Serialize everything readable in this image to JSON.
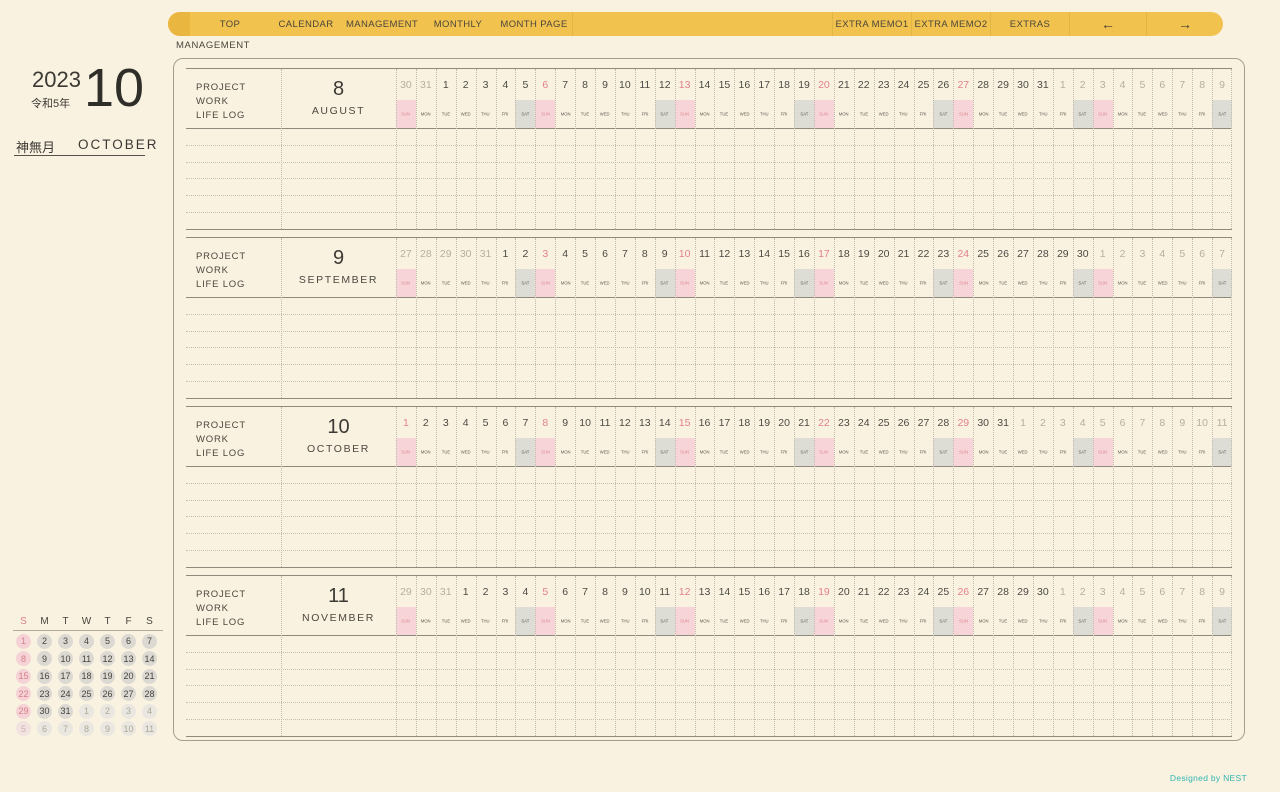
{
  "page_label": "MANAGEMENT",
  "nav": {
    "bar_color": "#F2C24F",
    "left_items": [
      "TOP",
      "CALENDAR",
      "MANAGEMENT",
      "MONTHLY",
      "MONTH PAGE"
    ],
    "right_items": [
      "EXTRA MEMO1",
      "EXTRA MEMO2",
      "EXTRAS"
    ],
    "prev_arrow": "←",
    "next_arrow": "→"
  },
  "sidebar": {
    "year": "2023",
    "era": "令和5年",
    "month_number": "10",
    "month_jp": "神無月",
    "month_en": "OCTOBER",
    "mini_calendar": {
      "weekday_header": [
        "S",
        "M",
        "T",
        "W",
        "T",
        "F",
        "S"
      ],
      "weeks": [
        [
          {
            "d": 1
          },
          {
            "d": 2
          },
          {
            "d": 3
          },
          {
            "d": 4
          },
          {
            "d": 5
          },
          {
            "d": 6
          },
          {
            "d": 7
          }
        ],
        [
          {
            "d": 8
          },
          {
            "d": 9
          },
          {
            "d": 10
          },
          {
            "d": 11
          },
          {
            "d": 12
          },
          {
            "d": 13
          },
          {
            "d": 14
          }
        ],
        [
          {
            "d": 15
          },
          {
            "d": 16
          },
          {
            "d": 17
          },
          {
            "d": 18
          },
          {
            "d": 19
          },
          {
            "d": 20
          },
          {
            "d": 21
          }
        ],
        [
          {
            "d": 22
          },
          {
            "d": 23
          },
          {
            "d": 24
          },
          {
            "d": 25
          },
          {
            "d": 26
          },
          {
            "d": 27
          },
          {
            "d": 28
          }
        ],
        [
          {
            "d": 29
          },
          {
            "d": 30
          },
          {
            "d": 31
          },
          {
            "d": 1,
            "o": 1
          },
          {
            "d": 2,
            "o": 1
          },
          {
            "d": 3,
            "o": 1
          },
          {
            "d": 4,
            "o": 1
          }
        ],
        [
          {
            "d": 5,
            "o": 1
          },
          {
            "d": 6,
            "o": 1
          },
          {
            "d": 7,
            "o": 1
          },
          {
            "d": 8,
            "o": 1
          },
          {
            "d": 9,
            "o": 1
          },
          {
            "d": 10,
            "o": 1
          },
          {
            "d": 11,
            "o": 1
          }
        ]
      ]
    }
  },
  "board": {
    "row_labels": [
      "PROJECT",
      "WORK",
      "LIFE LOG"
    ],
    "weekday_labels": [
      "SUN",
      "MON",
      "TUE",
      "WED",
      "THU",
      "FRI",
      "SAT"
    ],
    "sunday_highlight": "#F7D4D7",
    "saturday_highlight": "#DDDCD5",
    "sunday_text": "#E2808E",
    "months": [
      {
        "number": "8",
        "name": "AUGUST",
        "cells": [
          {
            "d": 30,
            "o": 1
          },
          {
            "d": 31,
            "o": 1
          },
          {
            "d": 1
          },
          {
            "d": 2
          },
          {
            "d": 3
          },
          {
            "d": 4
          },
          {
            "d": 5
          },
          {
            "d": 6
          },
          {
            "d": 7
          },
          {
            "d": 8
          },
          {
            "d": 9
          },
          {
            "d": 10
          },
          {
            "d": 11
          },
          {
            "d": 12
          },
          {
            "d": 13
          },
          {
            "d": 14
          },
          {
            "d": 15
          },
          {
            "d": 16
          },
          {
            "d": 17
          },
          {
            "d": 18
          },
          {
            "d": 19
          },
          {
            "d": 20
          },
          {
            "d": 21
          },
          {
            "d": 22
          },
          {
            "d": 23
          },
          {
            "d": 24
          },
          {
            "d": 25
          },
          {
            "d": 26
          },
          {
            "d": 27
          },
          {
            "d": 28
          },
          {
            "d": 29
          },
          {
            "d": 30
          },
          {
            "d": 31
          },
          {
            "d": 1,
            "o": 1
          },
          {
            "d": 2,
            "o": 1
          },
          {
            "d": 3,
            "o": 1
          },
          {
            "d": 4,
            "o": 1
          },
          {
            "d": 5,
            "o": 1
          },
          {
            "d": 6,
            "o": 1
          },
          {
            "d": 7,
            "o": 1
          },
          {
            "d": 8,
            "o": 1
          },
          {
            "d": 9,
            "o": 1
          }
        ]
      },
      {
        "number": "9",
        "name": "SEPTEMBER",
        "cells": [
          {
            "d": 27,
            "o": 1
          },
          {
            "d": 28,
            "o": 1
          },
          {
            "d": 29,
            "o": 1
          },
          {
            "d": 30,
            "o": 1
          },
          {
            "d": 31,
            "o": 1
          },
          {
            "d": 1
          },
          {
            "d": 2
          },
          {
            "d": 3
          },
          {
            "d": 4
          },
          {
            "d": 5
          },
          {
            "d": 6
          },
          {
            "d": 7
          },
          {
            "d": 8
          },
          {
            "d": 9
          },
          {
            "d": 10
          },
          {
            "d": 11
          },
          {
            "d": 12
          },
          {
            "d": 13
          },
          {
            "d": 14
          },
          {
            "d": 15
          },
          {
            "d": 16
          },
          {
            "d": 17
          },
          {
            "d": 18
          },
          {
            "d": 19
          },
          {
            "d": 20
          },
          {
            "d": 21
          },
          {
            "d": 22
          },
          {
            "d": 23
          },
          {
            "d": 24
          },
          {
            "d": 25
          },
          {
            "d": 26
          },
          {
            "d": 27
          },
          {
            "d": 28
          },
          {
            "d": 29
          },
          {
            "d": 30
          },
          {
            "d": 1,
            "o": 1
          },
          {
            "d": 2,
            "o": 1
          },
          {
            "d": 3,
            "o": 1
          },
          {
            "d": 4,
            "o": 1
          },
          {
            "d": 5,
            "o": 1
          },
          {
            "d": 6,
            "o": 1
          },
          {
            "d": 7,
            "o": 1
          }
        ]
      },
      {
        "number": "10",
        "name": "OCTOBER",
        "cells": [
          {
            "d": 1
          },
          {
            "d": 2
          },
          {
            "d": 3
          },
          {
            "d": 4
          },
          {
            "d": 5
          },
          {
            "d": 6
          },
          {
            "d": 7
          },
          {
            "d": 8
          },
          {
            "d": 9
          },
          {
            "d": 10
          },
          {
            "d": 11
          },
          {
            "d": 12
          },
          {
            "d": 13
          },
          {
            "d": 14
          },
          {
            "d": 15
          },
          {
            "d": 16
          },
          {
            "d": 17
          },
          {
            "d": 18
          },
          {
            "d": 19
          },
          {
            "d": 20
          },
          {
            "d": 21
          },
          {
            "d": 22
          },
          {
            "d": 23
          },
          {
            "d": 24
          },
          {
            "d": 25
          },
          {
            "d": 26
          },
          {
            "d": 27
          },
          {
            "d": 28
          },
          {
            "d": 29
          },
          {
            "d": 30
          },
          {
            "d": 31
          },
          {
            "d": 1,
            "o": 1
          },
          {
            "d": 2,
            "o": 1
          },
          {
            "d": 3,
            "o": 1
          },
          {
            "d": 4,
            "o": 1
          },
          {
            "d": 5,
            "o": 1
          },
          {
            "d": 6,
            "o": 1
          },
          {
            "d": 7,
            "o": 1
          },
          {
            "d": 8,
            "o": 1
          },
          {
            "d": 9,
            "o": 1
          },
          {
            "d": 10,
            "o": 1
          },
          {
            "d": 11,
            "o": 1
          }
        ]
      },
      {
        "number": "11",
        "name": "NOVEMBER",
        "cells": [
          {
            "d": 29,
            "o": 1
          },
          {
            "d": 30,
            "o": 1
          },
          {
            "d": 31,
            "o": 1
          },
          {
            "d": 1
          },
          {
            "d": 2
          },
          {
            "d": 3
          },
          {
            "d": 4
          },
          {
            "d": 5
          },
          {
            "d": 6
          },
          {
            "d": 7
          },
          {
            "d": 8
          },
          {
            "d": 9
          },
          {
            "d": 10
          },
          {
            "d": 11
          },
          {
            "d": 12
          },
          {
            "d": 13
          },
          {
            "d": 14
          },
          {
            "d": 15
          },
          {
            "d": 16
          },
          {
            "d": 17
          },
          {
            "d": 18
          },
          {
            "d": 19
          },
          {
            "d": 20
          },
          {
            "d": 21
          },
          {
            "d": 22
          },
          {
            "d": 23
          },
          {
            "d": 24
          },
          {
            "d": 25
          },
          {
            "d": 26
          },
          {
            "d": 27
          },
          {
            "d": 28
          },
          {
            "d": 29
          },
          {
            "d": 30
          },
          {
            "d": 1,
            "o": 1
          },
          {
            "d": 2,
            "o": 1
          },
          {
            "d": 3,
            "o": 1
          },
          {
            "d": 4,
            "o": 1
          },
          {
            "d": 5,
            "o": 1
          },
          {
            "d": 6,
            "o": 1
          },
          {
            "d": 7,
            "o": 1
          },
          {
            "d": 8,
            "o": 1
          },
          {
            "d": 9,
            "o": 1
          }
        ]
      }
    ]
  },
  "footer": {
    "credit": "Designed by NEST",
    "credit_color": "#2FB5B0"
  }
}
